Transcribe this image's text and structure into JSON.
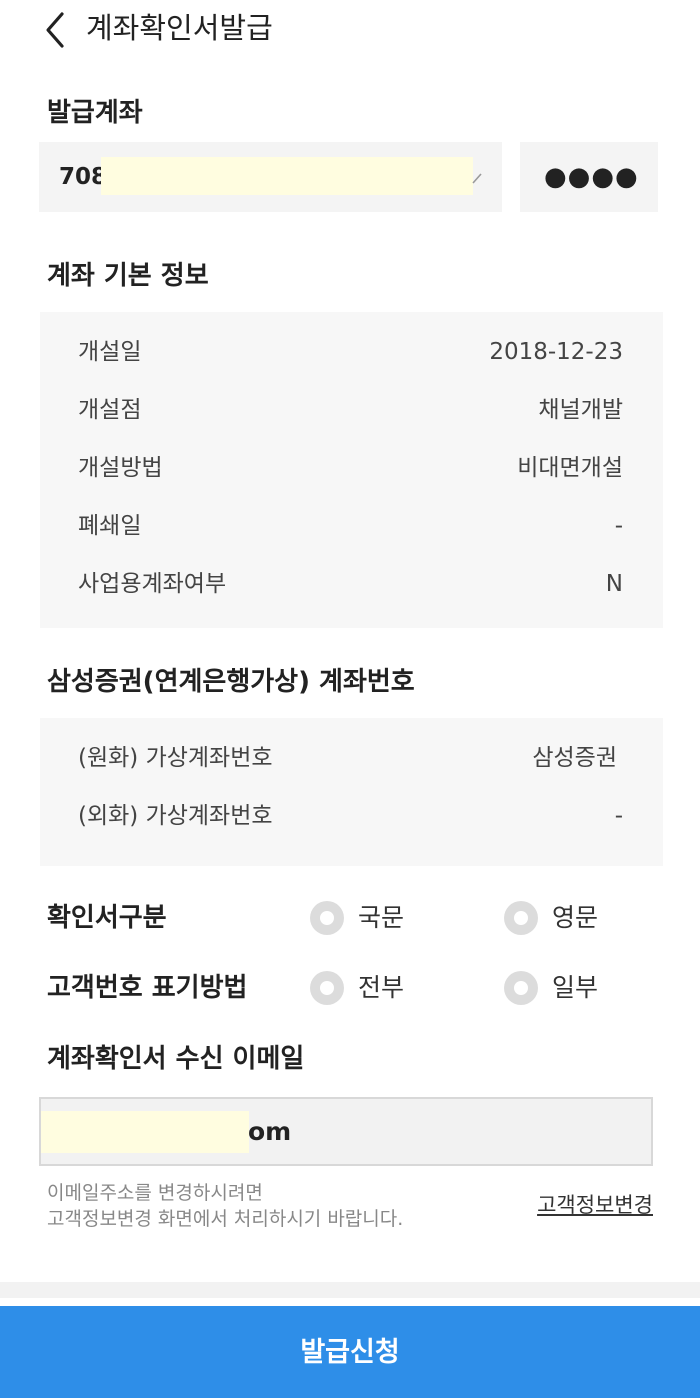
{
  "header": {
    "title": "계좌확인서발급"
  },
  "issue_account": {
    "section_title": "발급계좌",
    "account_number_visible": "708",
    "pin_mask": "●●●●"
  },
  "basic_info": {
    "section_title": "계좌 기본 정보",
    "rows": [
      {
        "label": "개설일",
        "value": "2018-12-23"
      },
      {
        "label": "개설점",
        "value": "채널개발"
      },
      {
        "label": "개설방법",
        "value": "비대면개설"
      },
      {
        "label": "폐쇄일",
        "value": "-"
      },
      {
        "label": "사업용계좌여부",
        "value": "N"
      }
    ]
  },
  "virtual_account": {
    "section_title": "삼성증권(연계은행가상) 계좌번호",
    "rows": [
      {
        "label": "(원화) 가상계좌번호",
        "value": "삼성증권"
      },
      {
        "label": "(외화) 가상계좌번호",
        "value": "-"
      }
    ]
  },
  "certificate_type": {
    "label": "확인서구분",
    "options": [
      "국문",
      "영문"
    ]
  },
  "customer_number_display": {
    "label": "고객번호 표기방법",
    "options": [
      "전부",
      "일부"
    ]
  },
  "email": {
    "section_title": "계좌확인서 수신 이메일",
    "value_visible": "om",
    "note_line1": "이메일주소를 변경하시려면",
    "note_line2": "고객정보변경 화면에서 처리하시기 바랍니다.",
    "change_link": "고객정보변경"
  },
  "submit": {
    "label": "발급신청"
  },
  "colors": {
    "primary": "#2e8ee8",
    "panel": "#f7f7f7",
    "mask": "#fffde0"
  }
}
